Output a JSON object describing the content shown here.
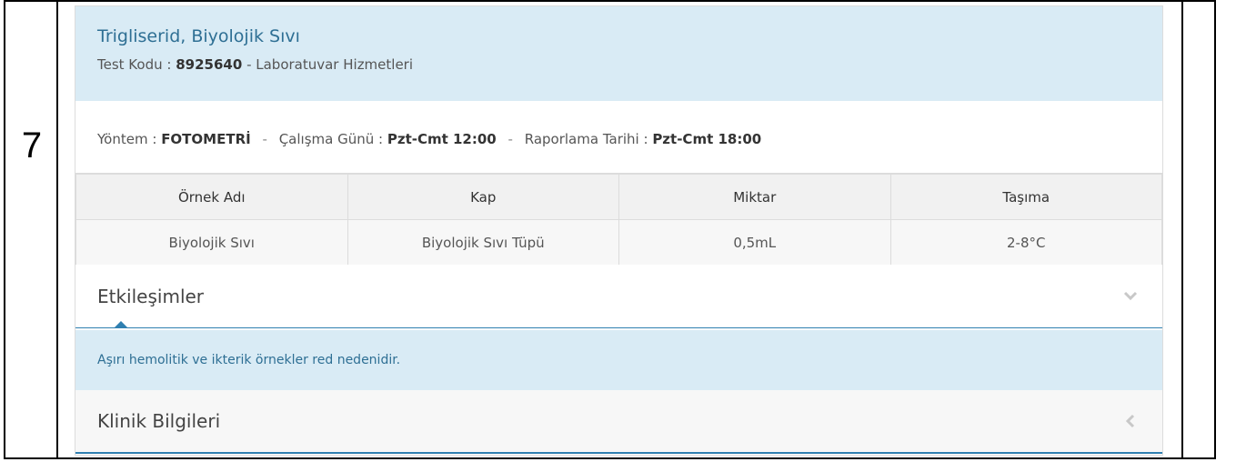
{
  "row_number": "7",
  "test": {
    "title": "Trigliserid, Biyolojik Sıvı",
    "code_label": "Test Kodu :",
    "code": "8925640",
    "department": "- Laboratuvar Hizmetleri"
  },
  "method": {
    "method_label": "Yöntem :",
    "method_value": "FOTOMETRİ",
    "workday_label": "Çalışma Günü :",
    "workday_value": "Pzt-Cmt 12:00",
    "report_label": "Raporlama Tarihi :",
    "report_value": "Pzt-Cmt 18:00",
    "separator": "-"
  },
  "specimen_table": {
    "headers": [
      "Örnek Adı",
      "Kap",
      "Miktar",
      "Taşıma"
    ],
    "rows": [
      [
        "Biyolojik Sıvı",
        "Biyolojik Sıvı Tüpü",
        "0,5mL",
        "2-8°C"
      ]
    ]
  },
  "interactions": {
    "title": "Etkileşimler",
    "icon": "chevron-down-icon",
    "body": "Aşırı hemolitik ve ikterik örnekler red nedenidir."
  },
  "clinical": {
    "title": "Klinik Bilgileri",
    "icon": "chevron-left-icon"
  },
  "colors": {
    "header_bg": "#d9ebf5",
    "accent": "#2f7fb0",
    "title_text": "#2e6f94"
  }
}
